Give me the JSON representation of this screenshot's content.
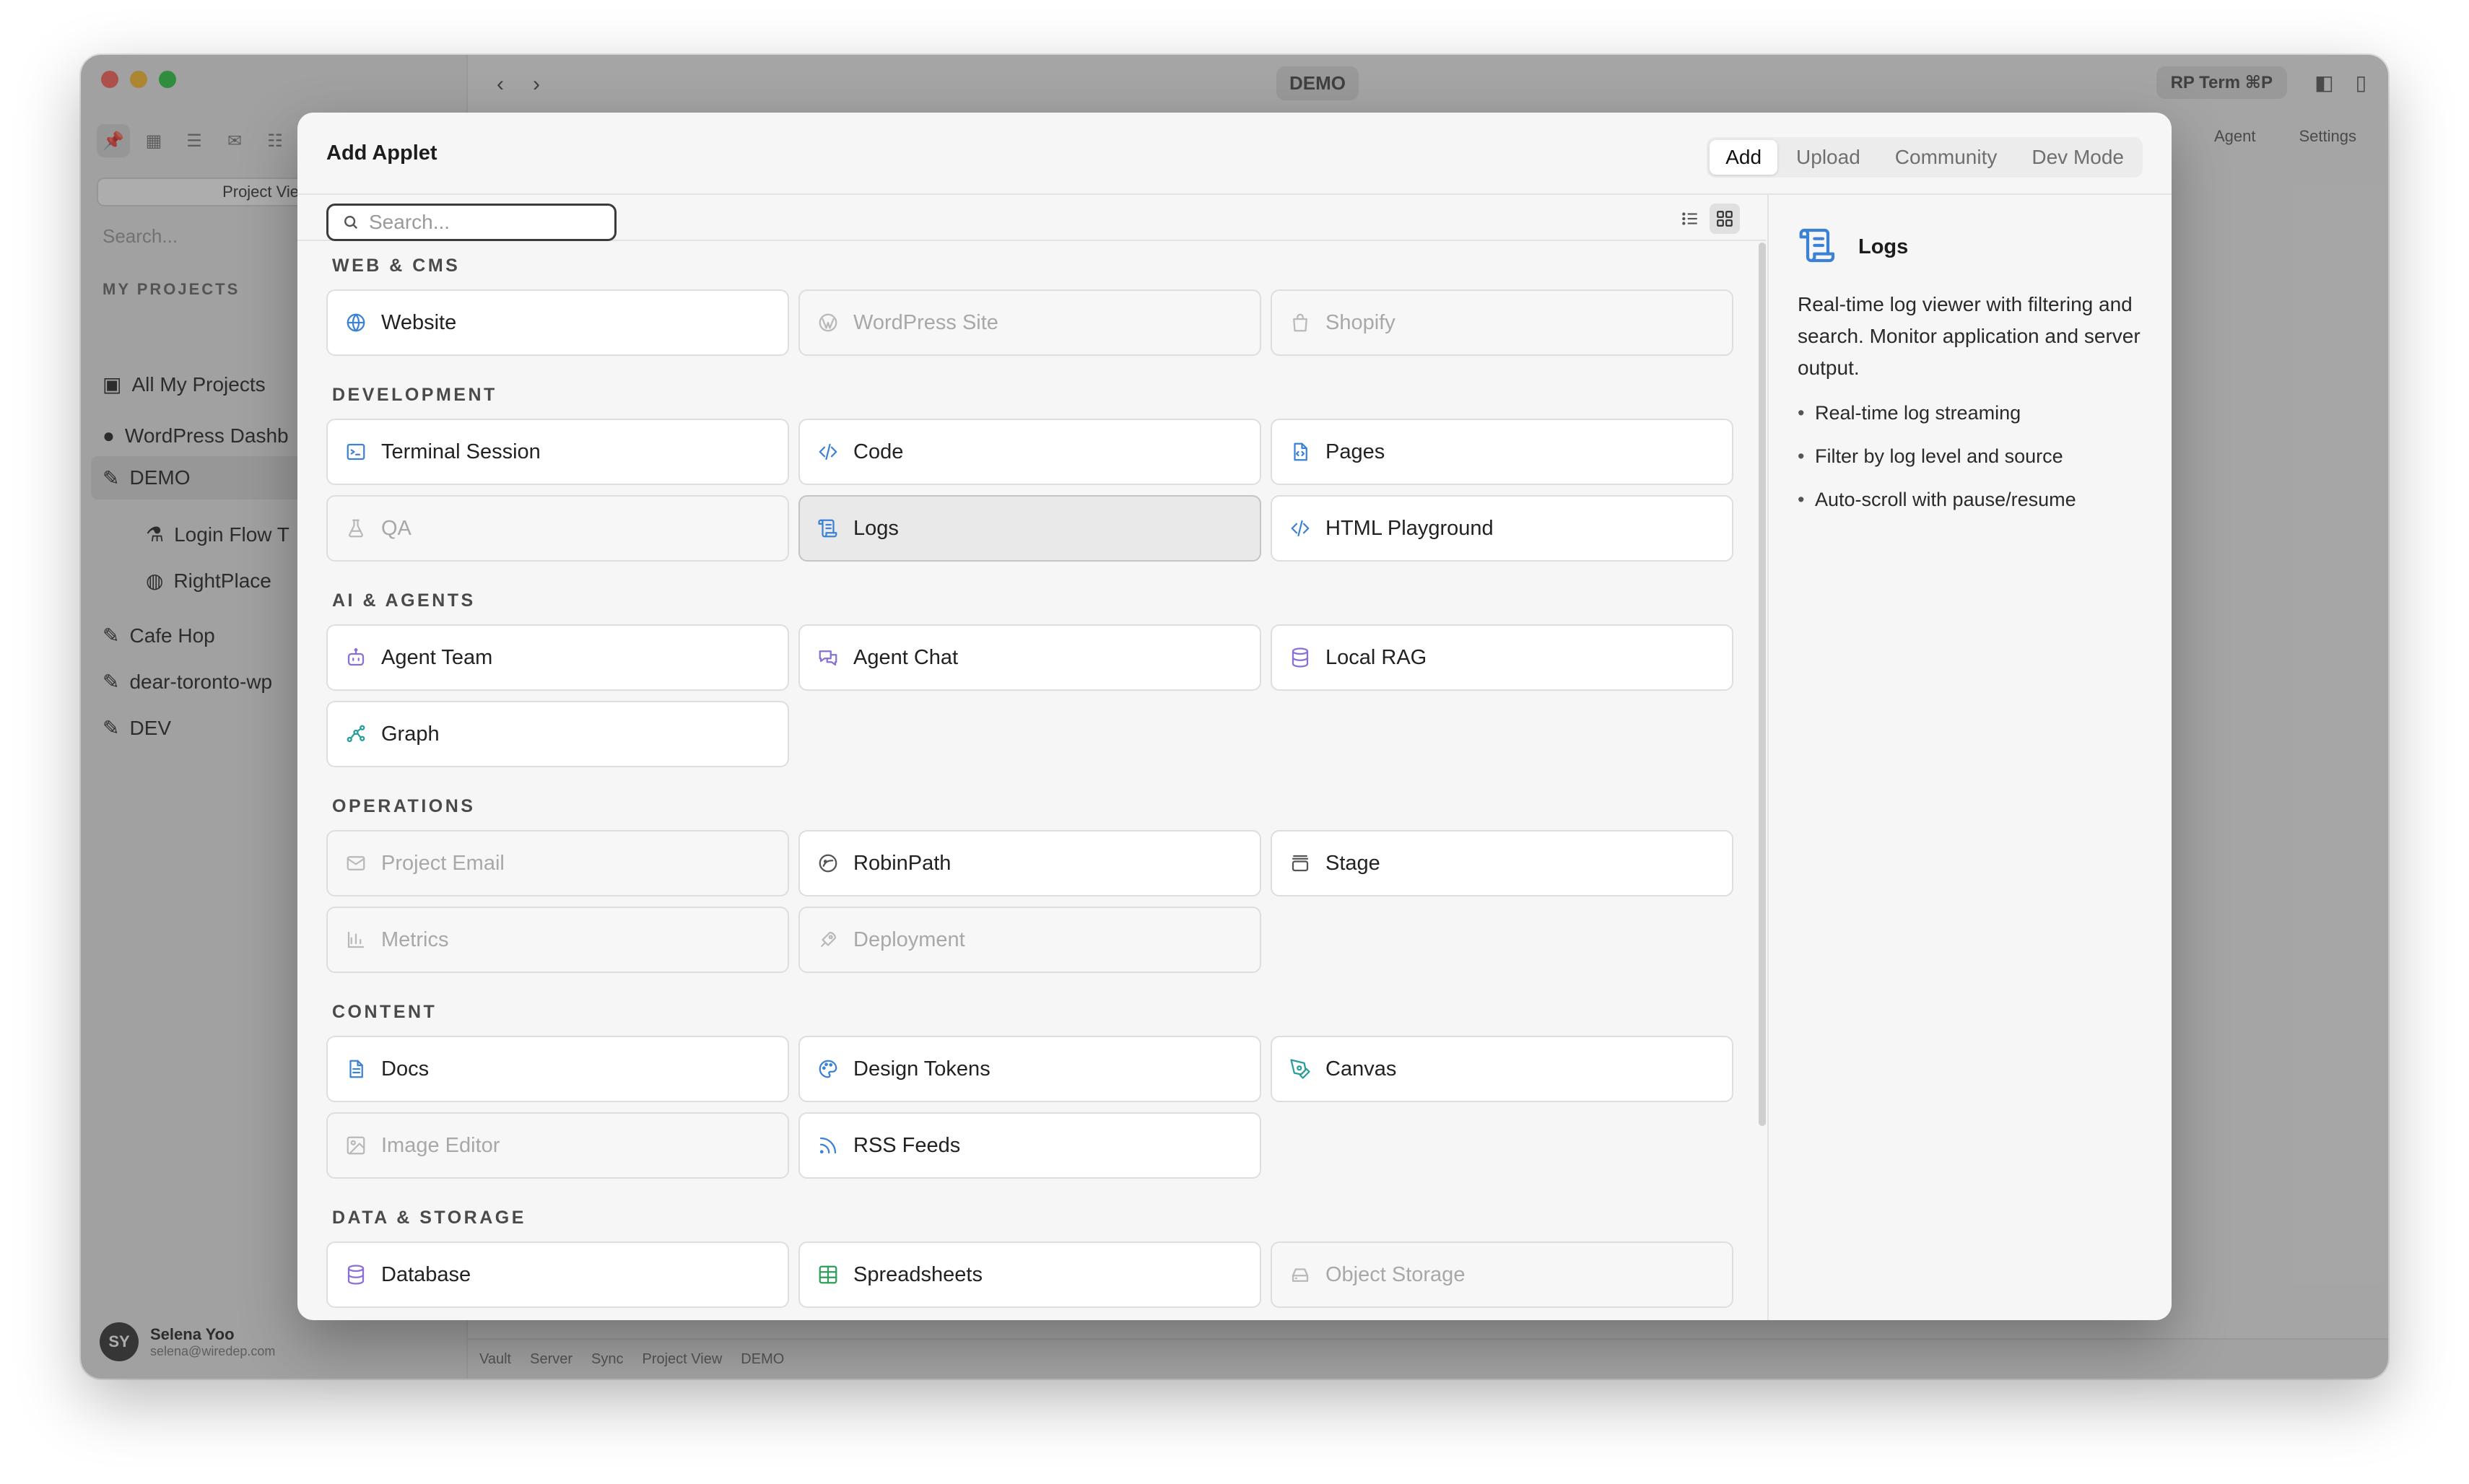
{
  "window": {
    "demo_tab": "DEMO",
    "rp_term": "RP Term  ⌘P",
    "sub_links": [
      "Agent",
      "Settings"
    ],
    "sidebar": {
      "project_view": "Project View",
      "search_placeholder": "Search...",
      "section": "MY PROJECTS",
      "items": [
        "All My Projects",
        "WordPress Dashb",
        "DEMO",
        "Login Flow T",
        "RightPlace",
        "Cafe Hop",
        "dear-toronto-wp",
        "DEV"
      ],
      "user_initials": "SY",
      "user_name": "Selena Yoo",
      "user_email": "selena@wiredep.com"
    },
    "statusbar": [
      "Vault",
      "Server",
      "Sync",
      "Project View",
      "DEMO"
    ]
  },
  "modal": {
    "title": "Add Applet",
    "tabs": [
      "Add",
      "Upload",
      "Community",
      "Dev Mode"
    ],
    "active_tab": "Add",
    "search_placeholder": "Search...",
    "categories": [
      {
        "label": "WEB & CMS",
        "items": [
          {
            "label": "Website",
            "icon": "globe-icon",
            "enabled": true
          },
          {
            "label": "WordPress Site",
            "icon": "wordpress-icon",
            "enabled": false
          },
          {
            "label": "Shopify",
            "icon": "shopping-bag-icon",
            "enabled": false
          }
        ]
      },
      {
        "label": "DEVELOPMENT",
        "items": [
          {
            "label": "Terminal Session",
            "icon": "terminal-icon",
            "enabled": true
          },
          {
            "label": "Code",
            "icon": "code-icon",
            "enabled": true
          },
          {
            "label": "Pages",
            "icon": "file-code-icon",
            "enabled": true
          },
          {
            "label": "QA",
            "icon": "flask-icon",
            "enabled": false
          },
          {
            "label": "Logs",
            "icon": "scroll-icon",
            "enabled": true,
            "selected": true
          },
          {
            "label": "HTML Playground",
            "icon": "code-icon",
            "enabled": true
          }
        ]
      },
      {
        "label": "AI & AGENTS",
        "items": [
          {
            "label": "Agent Team",
            "icon": "bot-icon",
            "enabled": true
          },
          {
            "label": "Agent Chat",
            "icon": "chat-icon",
            "enabled": true
          },
          {
            "label": "Local RAG",
            "icon": "database-icon",
            "enabled": true
          },
          {
            "label": "Graph",
            "icon": "graph-icon",
            "enabled": true
          }
        ]
      },
      {
        "label": "OPERATIONS",
        "items": [
          {
            "label": "Project Email",
            "icon": "mail-icon",
            "enabled": false
          },
          {
            "label": "RobinPath",
            "icon": "robinpath-icon",
            "enabled": true
          },
          {
            "label": "Stage",
            "icon": "stage-icon",
            "enabled": true
          },
          {
            "label": "Metrics",
            "icon": "bar-chart-icon",
            "enabled": false
          },
          {
            "label": "Deployment",
            "icon": "rocket-icon",
            "enabled": false
          }
        ]
      },
      {
        "label": "CONTENT",
        "items": [
          {
            "label": "Docs",
            "icon": "doc-icon",
            "enabled": true
          },
          {
            "label": "Design Tokens",
            "icon": "palette-icon",
            "enabled": true
          },
          {
            "label": "Canvas",
            "icon": "pen-tool-icon",
            "enabled": true
          },
          {
            "label": "Image Editor",
            "icon": "image-icon",
            "enabled": false
          },
          {
            "label": "RSS Feeds",
            "icon": "rss-icon",
            "enabled": true
          }
        ]
      },
      {
        "label": "DATA & STORAGE",
        "items": [
          {
            "label": "Database",
            "icon": "database-icon",
            "enabled": true
          },
          {
            "label": "Spreadsheets",
            "icon": "table-icon",
            "enabled": true
          },
          {
            "label": "Object Storage",
            "icon": "hard-drive-icon",
            "enabled": false
          }
        ]
      }
    ],
    "detail": {
      "icon": "scroll-icon",
      "title": "Logs",
      "description": "Real-time log viewer with filtering and search. Monitor application and server output.",
      "features": [
        "Real-time log streaming",
        "Filter by log level and source",
        "Auto-scroll with pause/resume"
      ]
    }
  },
  "colors": {
    "blue": "#3b82d6",
    "purple": "#8b6fd6",
    "teal": "#2a9d9a",
    "green": "#2e9e5b",
    "disabled": "#b9b9b9"
  }
}
